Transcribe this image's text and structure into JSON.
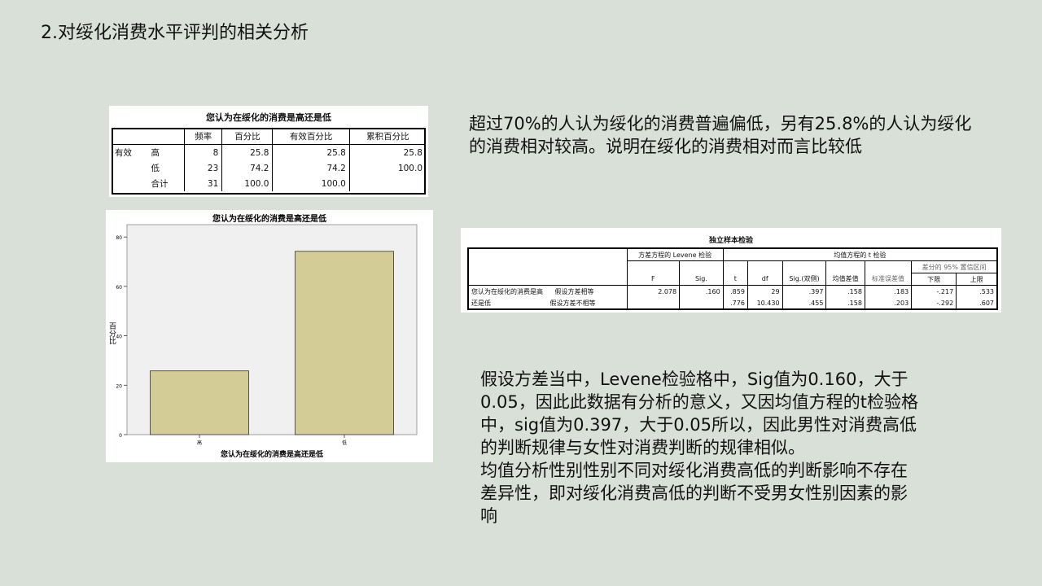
{
  "slide": {
    "title": "2.对绥化消费水平评判的相关分析"
  },
  "freq_table": {
    "caption": "您认为在绥化的消费是高还是低",
    "headers": [
      "",
      "",
      "频率",
      "百分比",
      "有效百分比",
      "累积百分比"
    ],
    "group_label": "有效",
    "rows": [
      {
        "label": "高",
        "freq": "8",
        "pct": "25.8",
        "valid_pct": "25.8",
        "cum_pct": "25.8"
      },
      {
        "label": "低",
        "freq": "23",
        "pct": "74.2",
        "valid_pct": "74.2",
        "cum_pct": "100.0"
      },
      {
        "label": "合计",
        "freq": "31",
        "pct": "100.0",
        "valid_pct": "100.0",
        "cum_pct": ""
      }
    ]
  },
  "chart_data": {
    "type": "bar",
    "title": "您认为在绥化的消费是高还是低",
    "xlabel": "您认为在绥化的消费是高还是低",
    "ylabel": "百分比",
    "categories": [
      "高",
      "低"
    ],
    "values": [
      25.8,
      74.2
    ],
    "ylim": [
      0,
      85
    ],
    "yticks": [
      0,
      20,
      40,
      60,
      80
    ],
    "bar_color": "#d4cc96",
    "plot_bg": "#f0f0f0",
    "grid": false,
    "legend": false
  },
  "ttest": {
    "caption": "独立样本检验",
    "levene_header": "方差方程的 Levene 检验",
    "ttest_header": "均值方程的 t 检验",
    "ci_header": "差分的 95% 置信区间",
    "columns": [
      "F",
      "Sig.",
      "t",
      "df",
      "Sig.(双侧)",
      "均值差值",
      "标准误差值",
      "下限",
      "上限"
    ],
    "row_label_1": "您认为在绥化的消费是高",
    "row_label_2": "还是低",
    "rows": [
      {
        "assumption": "假设方差相等",
        "F": "2.078",
        "Sig": ".160",
        "t": ".859",
        "df": "29",
        "sig2": ".397",
        "mean_diff": ".158",
        "se_diff": ".183",
        "lower": "-.217",
        "upper": ".533"
      },
      {
        "assumption": "假设方差不相等",
        "F": "",
        "Sig": "",
        "t": ".776",
        "df": "10.430",
        "sig2": ".455",
        "mean_diff": ".158",
        "se_diff": ".203",
        "lower": "-.292",
        "upper": ".607"
      }
    ]
  },
  "text": {
    "para1": "超过70%的人认为绥化的消费普遍偏低，另有25.8%的人认为绥化的消费相对较高。说明在绥化的消费相对而言比较低",
    "para2_lines": [
      "假设方差当中，Levene检验格中，Sig值为0.160，大于",
      "0.05，因此此数据有分析的意义，又因均值方程的t检验格",
      "中，sig值为0.397，大于0.05所以，因此男性对消费高低",
      "的判断规律与女性对消费判断的规律相似。",
      "均值分析性别性别不同对绥化消费高低的判断影响不存在",
      "差异性，即对绥化消费高低的判断不受男女性别因素的影",
      "响"
    ]
  }
}
